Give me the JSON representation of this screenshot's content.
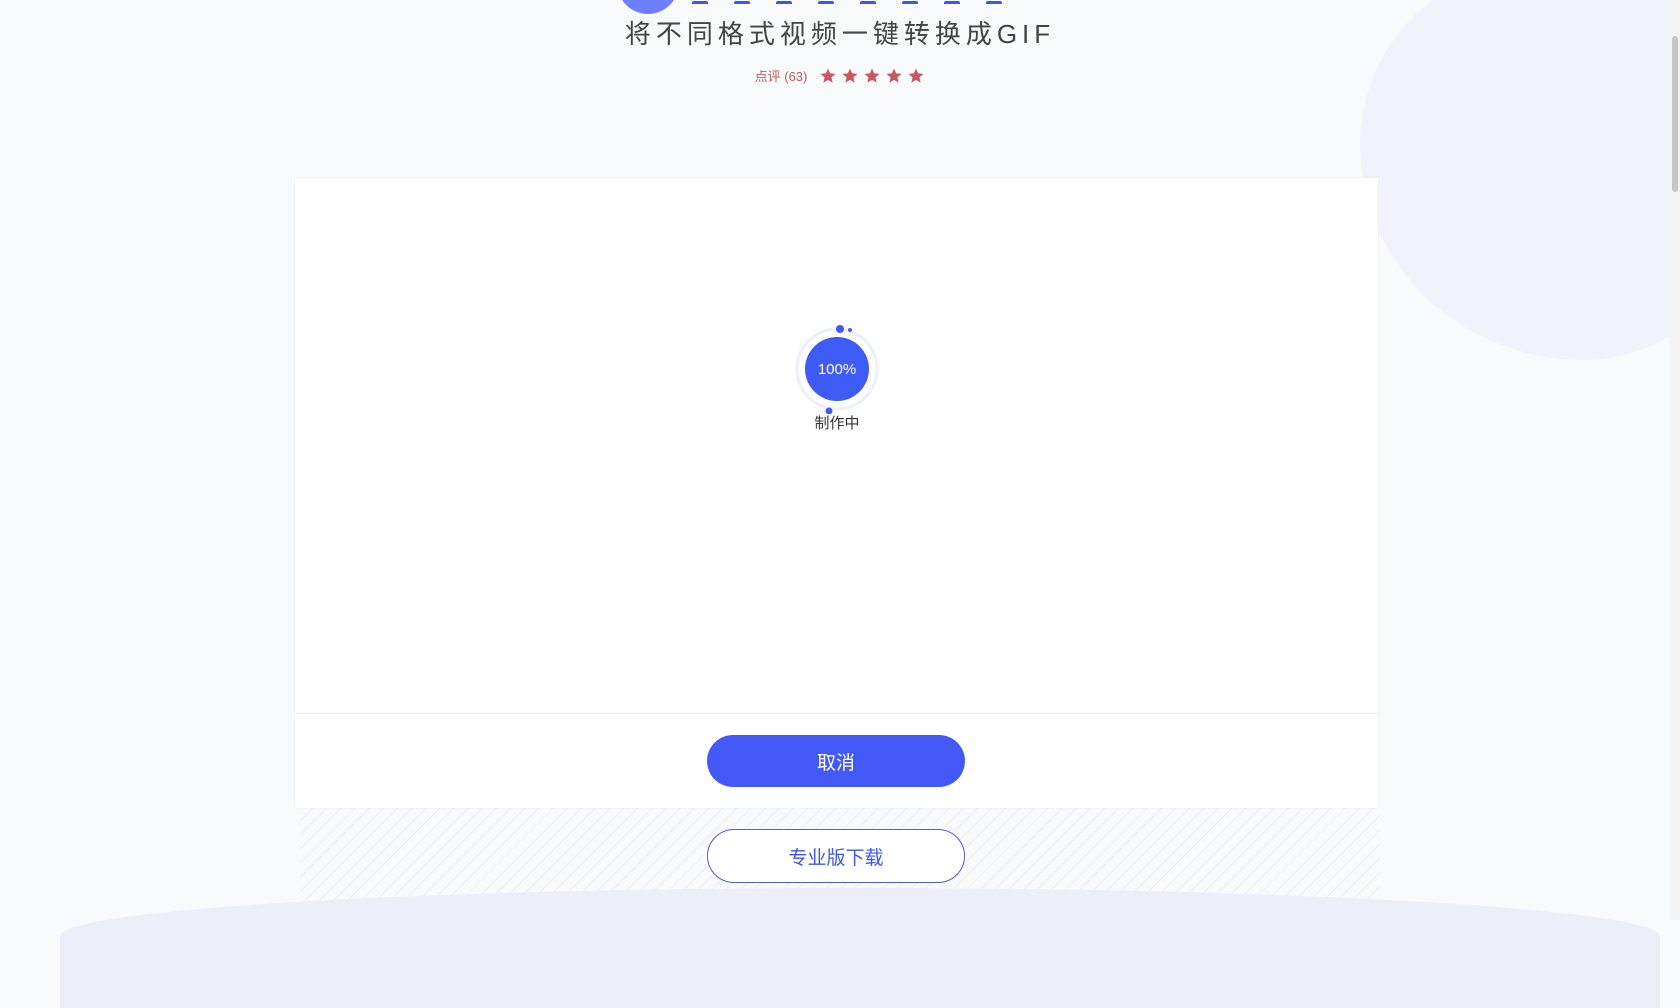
{
  "header": {
    "subtitle": "将不同格式视频一键转换成GIF",
    "reviews_label": "点评 (63)",
    "rating": 5,
    "rating_max": 5
  },
  "converter": {
    "progress_text": "100%",
    "progress": 1.0,
    "status_text": "制作中",
    "cancel_label": "取消"
  },
  "footer": {
    "pro_download_label": "专业版下载"
  },
  "colors": {
    "accent": "#4259f7",
    "star": "#c8585e"
  }
}
